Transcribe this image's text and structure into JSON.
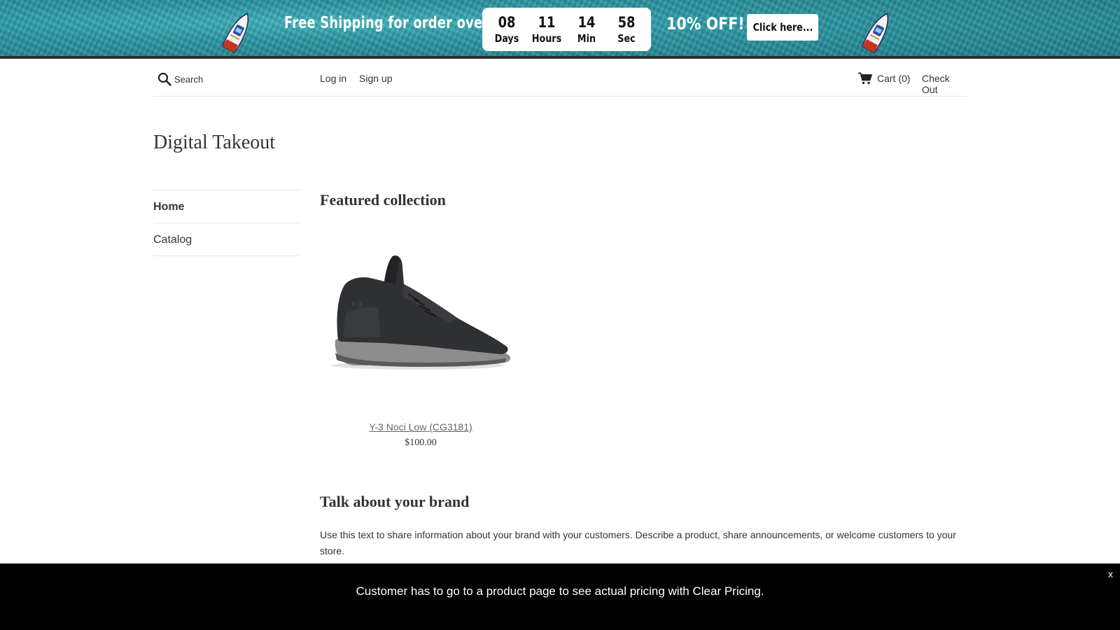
{
  "banner": {
    "message": "Free Shipping for order over",
    "countdown": [
      {
        "value": "08",
        "unit": "Days"
      },
      {
        "value": "11",
        "unit": "Hours"
      },
      {
        "value": "14",
        "unit": "Min"
      },
      {
        "value": "58",
        "unit": "Sec"
      }
    ],
    "offer": "10% OFF!",
    "button_label": "Click here...",
    "background_color": "#2a97a3",
    "icon": "speedboat-icon"
  },
  "header": {
    "search_placeholder": "Search",
    "login_label": "Log in",
    "signup_label": "Sign up",
    "cart_label": "Cart (0)",
    "checkout_label": "Check Out"
  },
  "sidebar": {
    "site_title": "Digital Takeout",
    "items": [
      {
        "label": "Home",
        "active": true
      },
      {
        "label": "Catalog",
        "active": false
      }
    ]
  },
  "main": {
    "featured_title": "Featured collection",
    "product": {
      "name": "Y-3 Noci Low (CG3181)",
      "price": "$100.00"
    },
    "brand_title": "Talk about your brand",
    "brand_text": "Use this text to share information about your brand with your customers. Describe a product, share announcements, or welcome customers to your store."
  },
  "notice": {
    "text": "Customer has to go to a product page to see actual pricing with Clear Pricing.",
    "close_label": "x"
  }
}
